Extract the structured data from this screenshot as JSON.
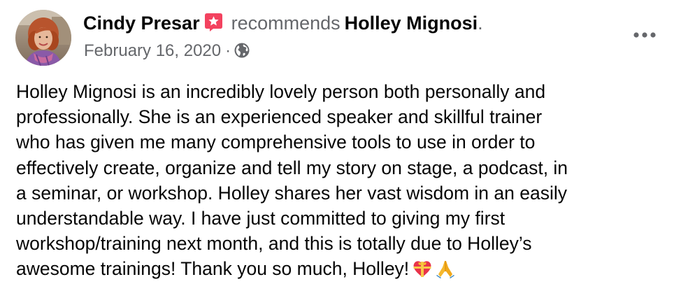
{
  "post": {
    "author": "Cindy Presar",
    "recommends_text": "recommends",
    "target": "Holley Mignosi",
    "period": ".",
    "date": "February 16, 2020",
    "separator": "·",
    "privacy_icon": "globe-icon",
    "recommendation_icon": "recommendation-star-icon",
    "more_icon": "more-options-icon",
    "body": "Holley Mignosi is an incredibly lovely person both personally and\nprofessionally. She is an experienced speaker and skillful trainer\nwho has given me many comprehensive tools to use in order to\neffectively create, organize and tell my story on stage, a podcast, in\na seminar, or workshop. Holley shares her vast wisdom in an easily\nunderstandable way. I have just committed to giving my first\nworkshop/training next month, and this is totally due to Holley’s\nawesome trainings!  Thank you so much, Holley!",
    "emojis": [
      "heart-with-ribbon-icon",
      "folded-hands-icon"
    ]
  },
  "colors": {
    "recommend_badge": "#f3425f",
    "secondary_text": "#65676b",
    "primary_text": "#050505"
  }
}
